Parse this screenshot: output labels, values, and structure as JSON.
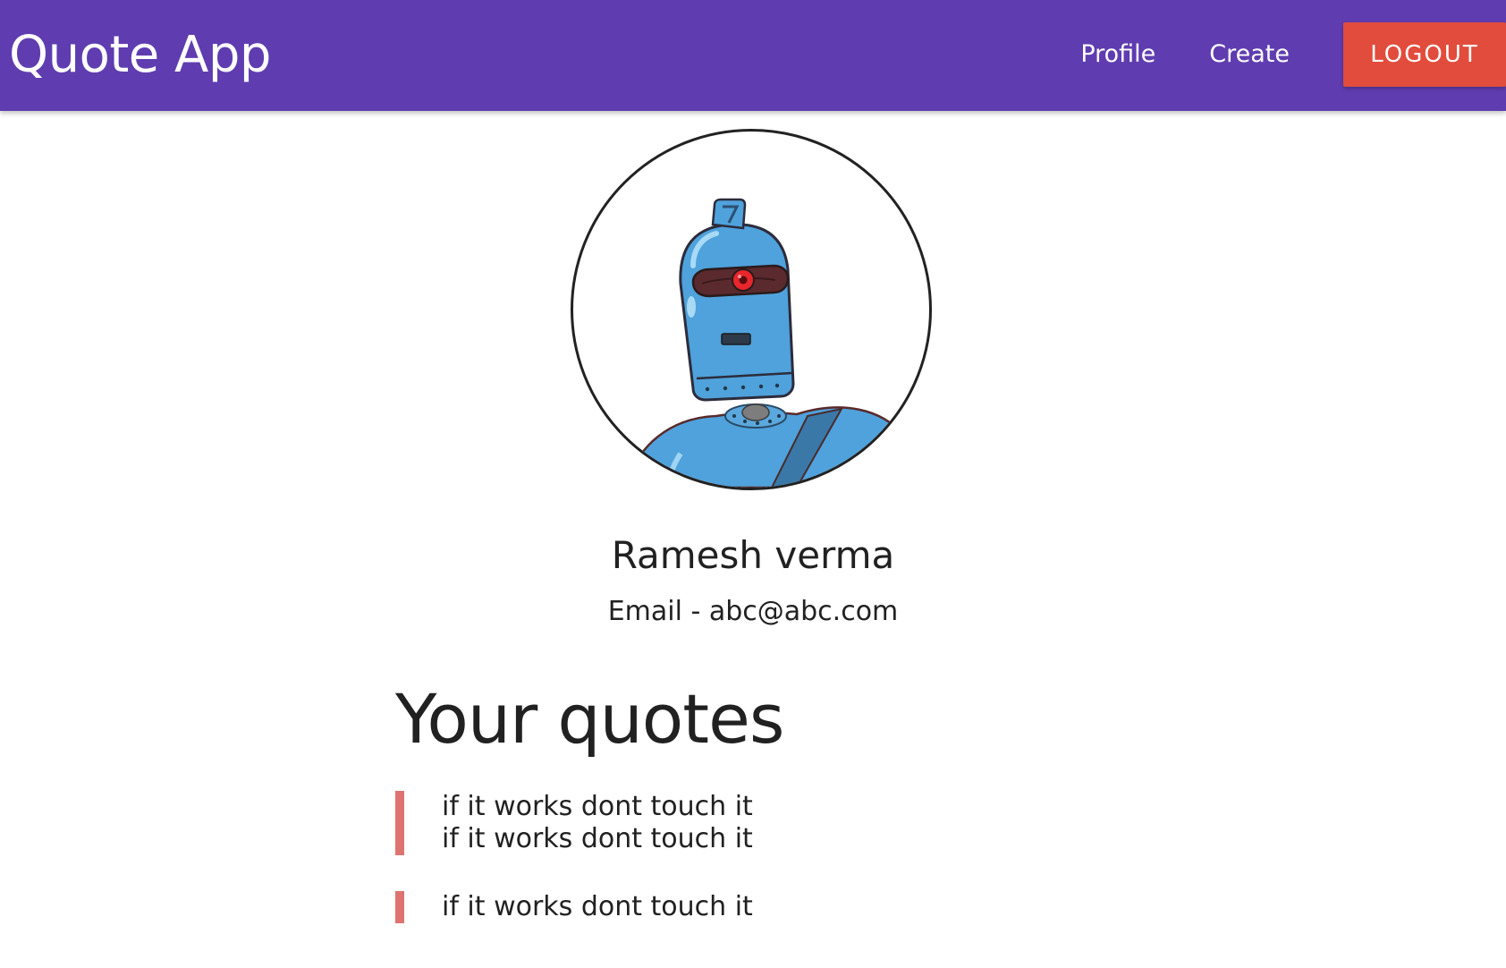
{
  "app": {
    "title": "Quote App"
  },
  "nav": {
    "profile_label": "Profile",
    "create_label": "Create",
    "logout_label": "LOGOUT"
  },
  "colors": {
    "navbar_bg": "#5f3db0",
    "logout_bg": "#e14c3c",
    "quote_border": "#de7471"
  },
  "profile": {
    "avatar_icon": "robot-avatar-icon",
    "name": "Ramesh verma",
    "email_text": "Email - abc@abc.com"
  },
  "quotes": {
    "heading": "Your quotes",
    "items": [
      {
        "lines": [
          "if it works dont touch it",
          "if it works dont touch it"
        ]
      },
      {
        "lines": [
          "if it works dont touch it"
        ]
      }
    ]
  }
}
